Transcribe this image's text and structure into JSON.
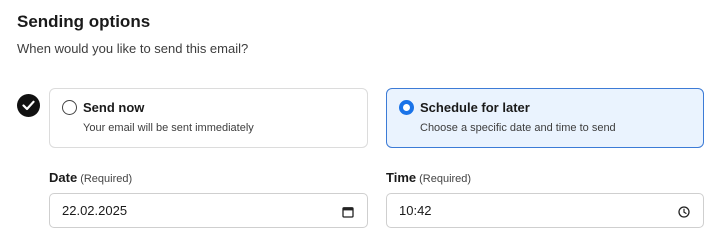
{
  "header": {
    "title": "Sending options",
    "subtitle": "When would you like to send this email?"
  },
  "options": [
    {
      "label": "Send now",
      "description": "Your email will be sent immediately",
      "selected": false
    },
    {
      "label": "Schedule for later",
      "description": "Choose a specific date and time to send",
      "selected": true
    }
  ],
  "date_field": {
    "label": "Date",
    "required_note": "(Required)",
    "value": "22.02.2025",
    "icon": "calendar-icon"
  },
  "time_field": {
    "label": "Time",
    "required_note": "(Required)",
    "value": "10:42",
    "icon": "clock-icon"
  },
  "colors": {
    "accent": "#1a73e8",
    "selected_bg": "#eaf3fe",
    "selected_border": "#3c7bd6",
    "check_bg": "#111111"
  }
}
